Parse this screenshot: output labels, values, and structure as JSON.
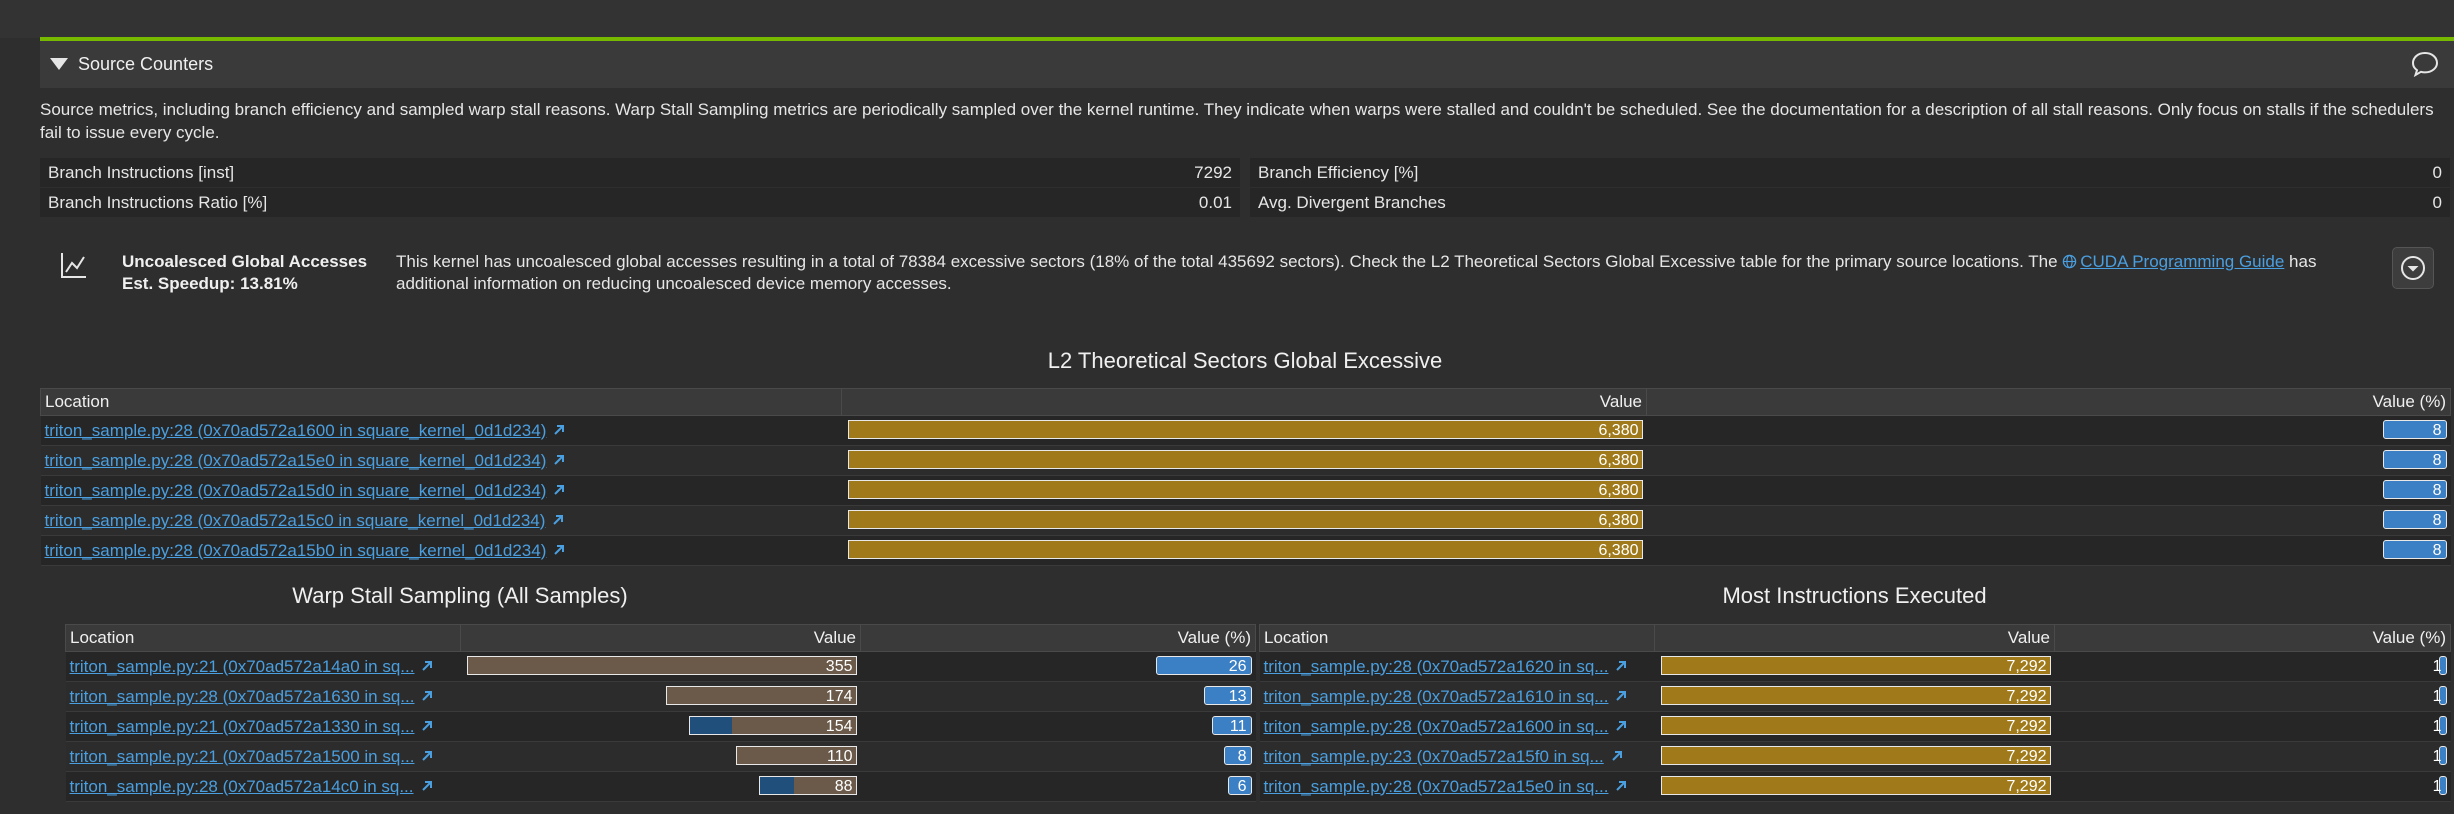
{
  "section": {
    "title": "Source Counters"
  },
  "description": "Source metrics, including branch efficiency and sampled warp stall reasons. Warp Stall Sampling metrics are periodically sampled over the kernel runtime. They indicate when warps were stalled and couldn't be scheduled. See the documentation for a description of all stall reasons. Only focus on stalls if the schedulers fail to issue every cycle.",
  "metrics": [
    {
      "label": "Branch Instructions [inst]",
      "value": "7292",
      "label2": "Branch Efficiency [%]",
      "value2": "0"
    },
    {
      "label": "Branch Instructions Ratio [%]",
      "value": "0.01",
      "label2": "Avg. Divergent Branches",
      "value2": "0"
    }
  ],
  "rule": {
    "name": "Uncoalesced Global Accesses",
    "speedup": "Est. Speedup: 13.81%",
    "text_before": "This kernel has uncoalesced global accesses resulting in a total of 78384 excessive sectors (18% of the total 435692 sectors). Check the L2 Theoretical Sectors Global Excessive table for the primary source locations. The ",
    "link_text": "CUDA Programming Guide",
    "text_after": " has additional information on reducing uncoalesced device memory accesses."
  },
  "colors": {
    "accent": "#76b900",
    "gold": "#a07a1a",
    "blue": "#3b7fc4",
    "link": "#4a9fe0"
  },
  "l2_table": {
    "title": "L2 Theoretical Sectors Global Excessive",
    "headers": [
      "Location",
      "Value",
      "Value (%)"
    ],
    "rows": [
      {
        "location": "triton_sample.py:28 (0x70ad572a1600 in square_kernel_0d1d234)",
        "value": "6,380",
        "pct": "8",
        "frac": 1.0
      },
      {
        "location": "triton_sample.py:28 (0x70ad572a15e0 in square_kernel_0d1d234)",
        "value": "6,380",
        "pct": "8",
        "frac": 1.0
      },
      {
        "location": "triton_sample.py:28 (0x70ad572a15d0 in square_kernel_0d1d234)",
        "value": "6,380",
        "pct": "8",
        "frac": 1.0
      },
      {
        "location": "triton_sample.py:28 (0x70ad572a15c0 in square_kernel_0d1d234)",
        "value": "6,380",
        "pct": "8",
        "frac": 1.0
      },
      {
        "location": "triton_sample.py:28 (0x70ad572a15b0 in square_kernel_0d1d234)",
        "value": "6,380",
        "pct": "8",
        "frac": 1.0
      }
    ]
  },
  "warp_table": {
    "title": "Warp Stall Sampling (All Samples)",
    "headers": [
      "Location",
      "Value",
      "Value (%)"
    ],
    "rows": [
      {
        "location": "triton_sample.py:21 (0x70ad572a14a0 in sq...",
        "value": "355",
        "pct": "26",
        "frac": 1.0,
        "blue_frac": 0.0,
        "pct_frac": 0.24
      },
      {
        "location": "triton_sample.py:28 (0x70ad572a1630 in sq...",
        "value": "174",
        "pct": "13",
        "frac": 0.49,
        "blue_frac": 0.0,
        "pct_frac": 0.12
      },
      {
        "location": "triton_sample.py:21 (0x70ad572a1330 in sq...",
        "value": "154",
        "pct": "11",
        "frac": 0.43,
        "blue_frac": 0.25,
        "pct_frac": 0.1
      },
      {
        "location": "triton_sample.py:21 (0x70ad572a1500 in sq...",
        "value": "110",
        "pct": "8",
        "frac": 0.31,
        "blue_frac": 0.0,
        "pct_frac": 0.07
      },
      {
        "location": "triton_sample.py:28 (0x70ad572a14c0 in sq...",
        "value": "88",
        "pct": "6",
        "frac": 0.25,
        "blue_frac": 0.35,
        "pct_frac": 0.06
      }
    ]
  },
  "instr_table": {
    "title": "Most Instructions Executed",
    "headers": [
      "Location",
      "Value",
      "Value (%)"
    ],
    "rows": [
      {
        "location": "triton_sample.py:28 (0x70ad572a1620 in sq...",
        "value": "7,292",
        "pct": "1",
        "frac": 1.0
      },
      {
        "location": "triton_sample.py:28 (0x70ad572a1610 in sq...",
        "value": "7,292",
        "pct": "1",
        "frac": 1.0
      },
      {
        "location": "triton_sample.py:28 (0x70ad572a1600 in sq...",
        "value": "7,292",
        "pct": "1",
        "frac": 1.0
      },
      {
        "location": "triton_sample.py:23 (0x70ad572a15f0 in sq...",
        "value": "7,292",
        "pct": "1",
        "frac": 1.0
      },
      {
        "location": "triton_sample.py:28 (0x70ad572a15e0 in sq...",
        "value": "7,292",
        "pct": "1",
        "frac": 1.0
      }
    ]
  }
}
